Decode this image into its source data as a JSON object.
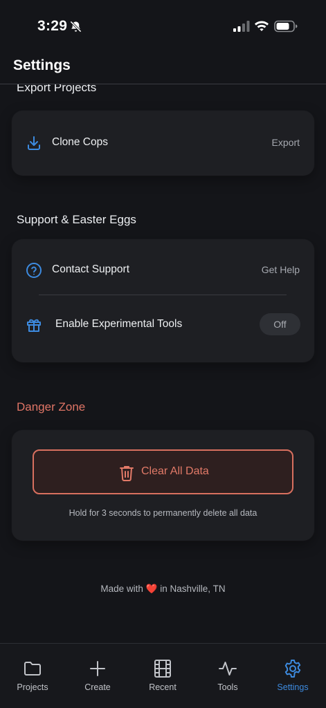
{
  "status_bar": {
    "time": "3:29"
  },
  "header": {
    "title": "Settings"
  },
  "export_section": {
    "title": "Export Projects",
    "item_label": "Clone Cops",
    "item_action": "Export"
  },
  "support_section": {
    "title": "Support & Easter Eggs",
    "contact_label": "Contact Support",
    "contact_action": "Get Help",
    "experimental_label": "Enable Experimental Tools",
    "experimental_value": "Off"
  },
  "danger_section": {
    "title": "Danger Zone",
    "button_label": "Clear All Data",
    "hint": "Hold for 3 seconds to permanently delete all data"
  },
  "footer": {
    "prefix": "Made with",
    "heart": "❤️",
    "suffix": "in Nashville, TN"
  },
  "tab_bar": {
    "tabs": [
      {
        "label": "Projects",
        "icon": "folder-icon"
      },
      {
        "label": "Create",
        "icon": "plus-icon"
      },
      {
        "label": "Recent",
        "icon": "film-icon"
      },
      {
        "label": "Tools",
        "icon": "activity-icon"
      },
      {
        "label": "Settings",
        "icon": "gear-icon"
      }
    ],
    "active_index": 4
  },
  "colors": {
    "background": "#141519",
    "card": "#1e1f23",
    "accent": "#3d8be0",
    "danger": "#e07566"
  }
}
